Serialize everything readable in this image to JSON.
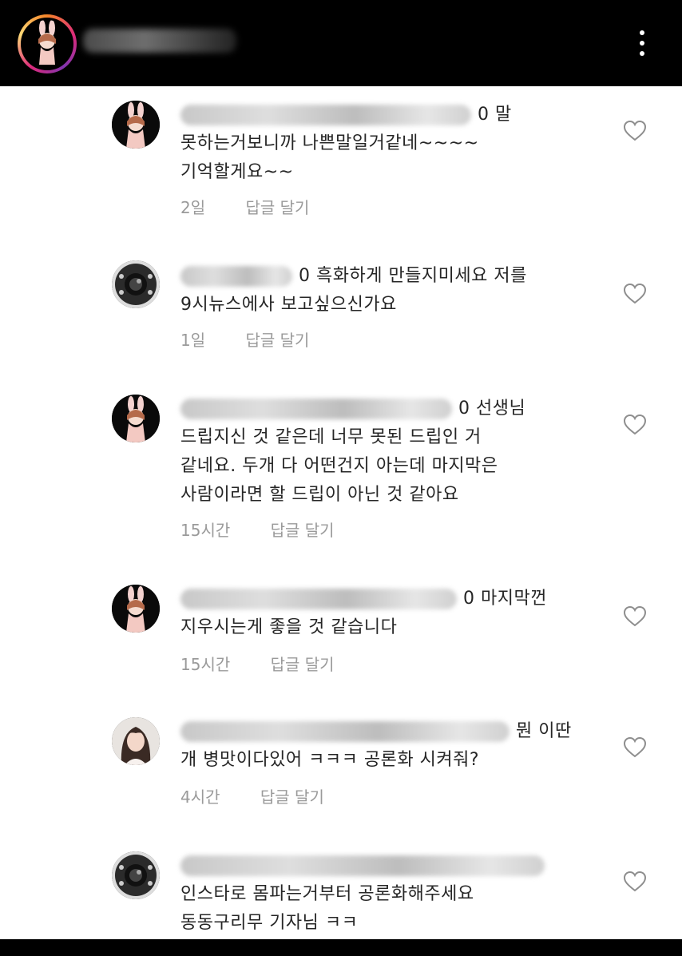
{
  "header": {
    "avatar_icon": "profile-avatar-bunny",
    "username_blurred": true,
    "more_icon": "more-vertical-icon"
  },
  "comments": [
    {
      "avatar": "bunny-avatar",
      "lines": [
        "0 말",
        "못하는거보니까 나쁜말일거같네~~~~",
        "기억할게요~~"
      ],
      "time": "2일",
      "reply": "답글 달기"
    },
    {
      "avatar": "camera-avatar",
      "lines": [
        "0 흑화하게 만들지미세요 저를",
        "9시뉴스에사 보고싶으신가요"
      ],
      "time": "1일",
      "reply": "답글 달기"
    },
    {
      "avatar": "bunny-avatar",
      "lines": [
        "0 선생님",
        "드립지신 것 같은데 너무 못된 드립인 거",
        "같네요. 두개 다 어떤건지 아는데 마지막은",
        "사람이라면 할 드립이 아닌 것 같아요"
      ],
      "time": "15시간",
      "reply": "답글 달기"
    },
    {
      "avatar": "bunny-avatar",
      "lines": [
        "0 마지막껀",
        "지우시는게 좋을 것 같습니다"
      ],
      "time": "15시간",
      "reply": "답글 달기"
    },
    {
      "avatar": "girl-photo-avatar",
      "lines": [
        "뭔 이딴",
        "개 병맛이다있어 ㅋㅋㅋ 공론화 시켜줘?"
      ],
      "time": "4시간",
      "reply": "답글 달기"
    },
    {
      "avatar": "camera-avatar",
      "lines": [
        "",
        "인스타로 몸파는거부터 공론화해주세요",
        "동동구리무 기자님 ㅋㅋ"
      ],
      "time": "",
      "reply": ""
    }
  ],
  "colors": {
    "text": "#262626",
    "meta": "#9a9a9a",
    "background": "#ffffff",
    "bar": "#000000"
  }
}
